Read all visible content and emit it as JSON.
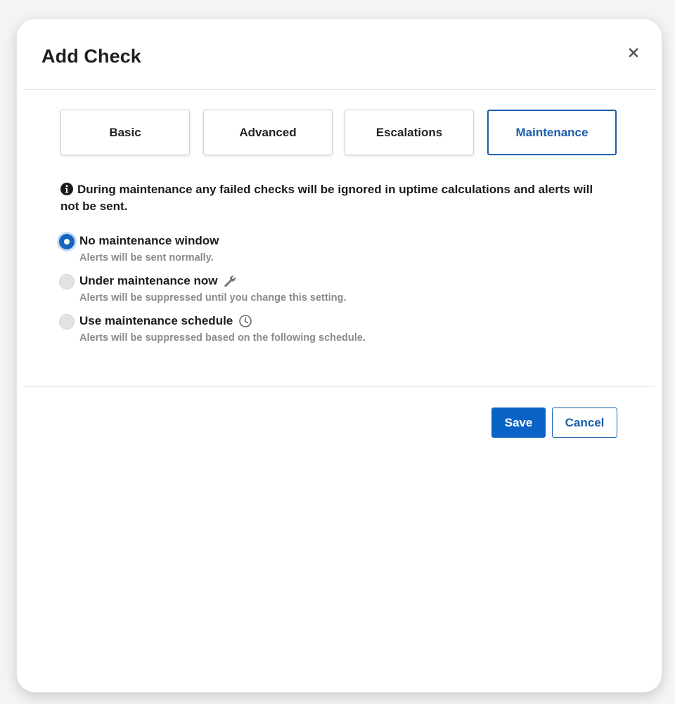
{
  "dialog": {
    "title": "Add Check",
    "close_icon": "close-icon"
  },
  "tabs": [
    {
      "label": "Basic",
      "active": false
    },
    {
      "label": "Advanced",
      "active": false
    },
    {
      "label": "Escalations",
      "active": false
    },
    {
      "label": "Maintenance",
      "active": true
    }
  ],
  "info": {
    "icon": "info-icon",
    "text": "During maintenance any failed checks will be ignored in uptime calculations and alerts will not be sent."
  },
  "options": [
    {
      "label": "No maintenance window",
      "description": "Alerts will be sent normally.",
      "checked": true,
      "icon": ""
    },
    {
      "label": "Under maintenance now",
      "description": "Alerts will be suppressed until you change this setting.",
      "checked": false,
      "icon": "wrench-icon"
    },
    {
      "label": "Use maintenance schedule",
      "description": "Alerts will be suppressed based on the following schedule.",
      "checked": false,
      "icon": "clock-icon"
    }
  ],
  "buttons": {
    "save": "Save",
    "cancel": "Cancel"
  },
  "colors": {
    "accent": "#0a63c6",
    "tab_active": "#1b5fa8",
    "muted_text": "#8a8a8a"
  }
}
